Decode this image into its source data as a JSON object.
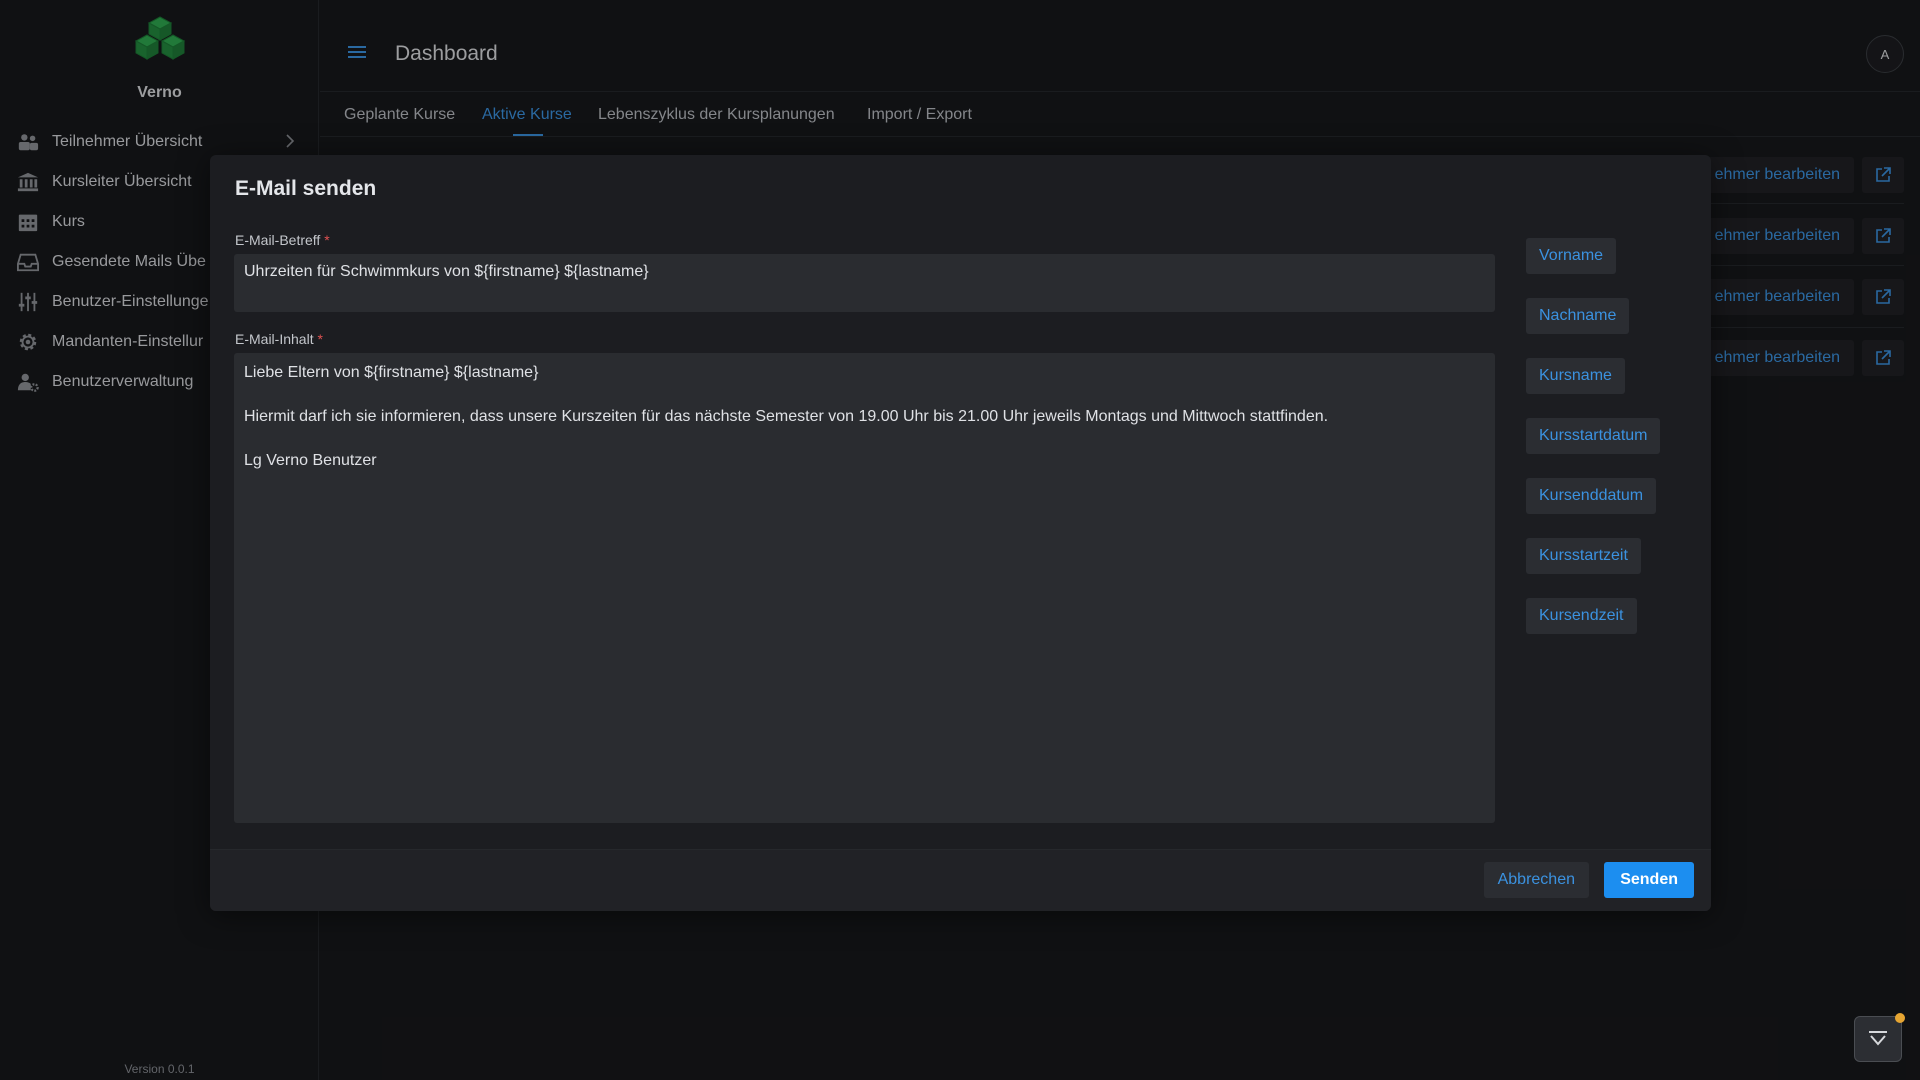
{
  "app": {
    "brand": "Verno",
    "version": "Version 0.0.1"
  },
  "colors": {
    "accent": "#3b92e0",
    "primary_button": "#1c8ef0",
    "logo_green": "#2fa84f",
    "required": "#e05252"
  },
  "sidebar": {
    "items": [
      {
        "label": "Teilnehmer Übersicht",
        "icon": "users-icon",
        "has_chevron": true
      },
      {
        "label": "Kursleiter Übersicht",
        "icon": "bank-icon"
      },
      {
        "label": "Kurs",
        "icon": "calendar-icon"
      },
      {
        "label": "Gesendete Mails Übe",
        "icon": "inbox-icon"
      },
      {
        "label": "Benutzer-Einstellunge",
        "icon": "sliders-icon"
      },
      {
        "label": "Mandanten-Einstellur",
        "icon": "gear-icon"
      },
      {
        "label": "Benutzerverwaltung",
        "icon": "user-cog-icon"
      }
    ]
  },
  "header": {
    "title": "Dashboard",
    "avatar_initial": "A"
  },
  "tabs": [
    {
      "label": "Geplante Kurse",
      "active": false
    },
    {
      "label": "Aktive Kurse",
      "active": true
    },
    {
      "label": "Lebenszyklus der Kursplanungen",
      "active": false
    },
    {
      "label": "Import / Export",
      "active": false
    }
  ],
  "background_rows": [
    {
      "action_label": "ehmer bearbeiten"
    },
    {
      "action_label": "ehmer bearbeiten"
    },
    {
      "action_label": "ehmer bearbeiten"
    },
    {
      "action_label": "ehmer bearbeiten"
    }
  ],
  "modal": {
    "title": "E-Mail senden",
    "subject_label": "E-Mail-Betreff",
    "subject_value": "Uhrzeiten für Schwimmkurs von ${firstname} ${lastname}",
    "body_label": "E-Mail-Inhalt",
    "required_marker": "*",
    "body_lines": [
      "Liebe Eltern von ${firstname} ${lastname}",
      "Hiermit darf ich sie informieren, dass unsere Kurszeiten für das nächste Semester von 19.00 Uhr bis 21.00 Uhr jeweils Montags und Mittwoch stattfinden.",
      "Lg Verno Benutzer"
    ],
    "placeholders": [
      "Vorname",
      "Nachname",
      "Kursname",
      "Kursstartdatum",
      "Kursenddatum",
      "Kursstartzeit",
      "Kursendzeit"
    ],
    "cancel_label": "Abbrechen",
    "send_label": "Senden"
  }
}
